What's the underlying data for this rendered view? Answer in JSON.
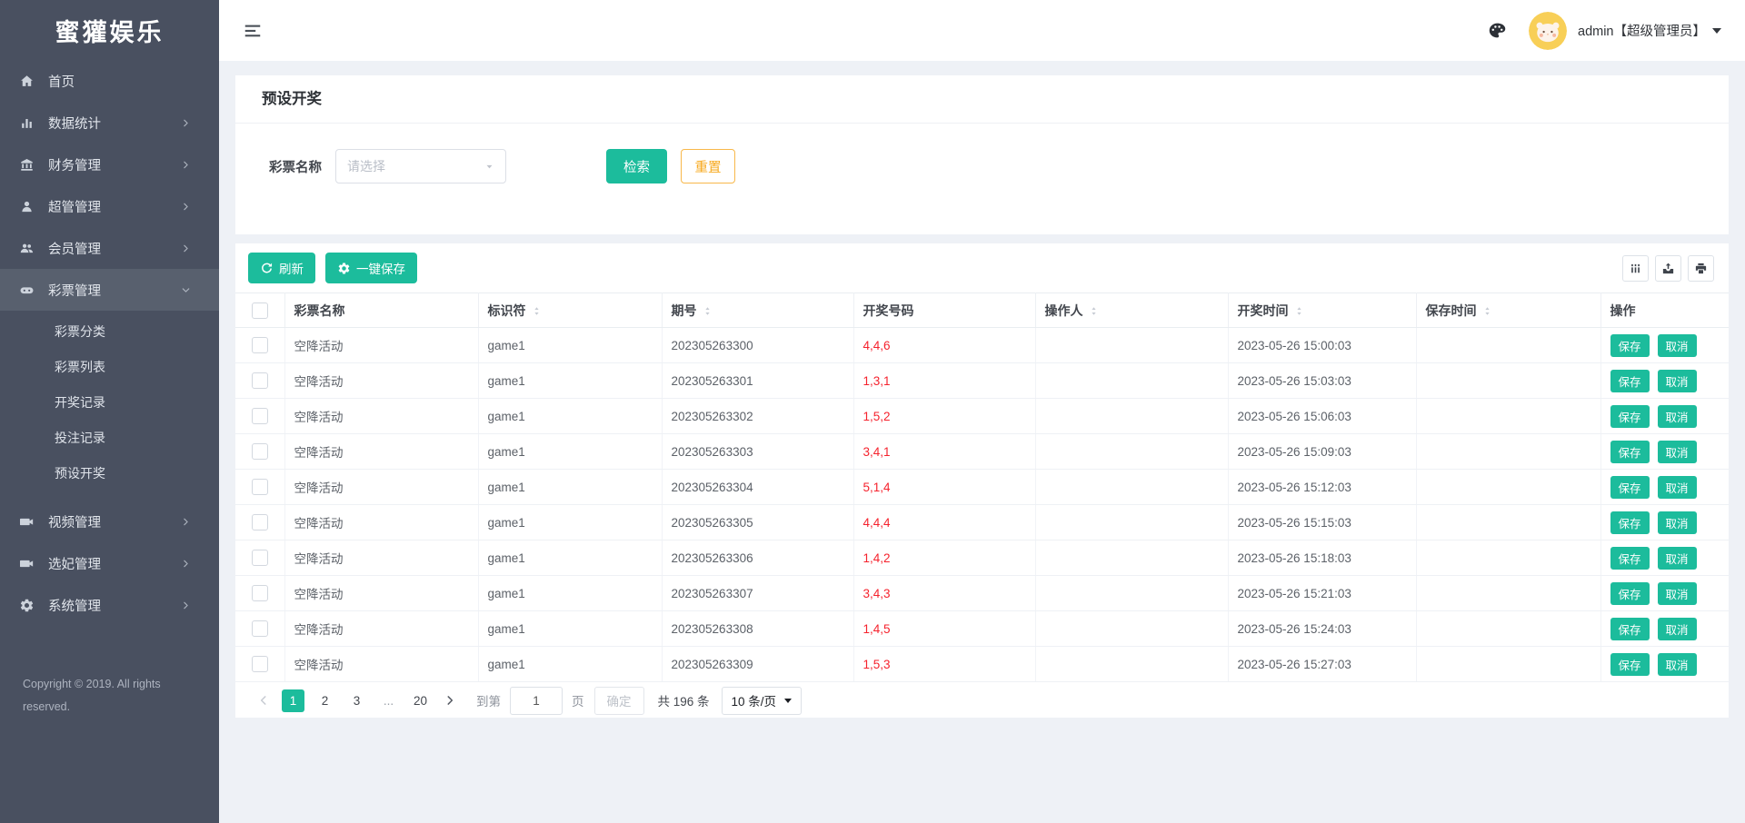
{
  "colors": {
    "accent": "#1cbc9c",
    "warning": "#f7a81c",
    "danger": "#f5222d",
    "sidebar_bg": "#495060",
    "sidebar_active_bg": "#58606e",
    "page_bg": "#eef1f6"
  },
  "sidebar": {
    "logo": "蜜獾娱乐",
    "items": [
      {
        "label": "首页",
        "icon": "home-icon",
        "expandable": false,
        "active": false
      },
      {
        "label": "数据统计",
        "icon": "chart-icon",
        "expandable": true,
        "active": false
      },
      {
        "label": "财务管理",
        "icon": "bank-icon",
        "expandable": true,
        "active": false
      },
      {
        "label": "超管管理",
        "icon": "user-icon",
        "expandable": true,
        "active": false
      },
      {
        "label": "会员管理",
        "icon": "users-icon",
        "expandable": true,
        "active": false
      },
      {
        "label": "彩票管理",
        "icon": "gamepad-icon",
        "expandable": true,
        "expanded": true,
        "active": true,
        "children": [
          "彩票分类",
          "彩票列表",
          "开奖记录",
          "投注记录",
          "预设开奖"
        ]
      },
      {
        "label": "视频管理",
        "icon": "video-icon",
        "expandable": true,
        "active": false
      },
      {
        "label": "选妃管理",
        "icon": "video-icon",
        "expandable": true,
        "active": false
      },
      {
        "label": "系统管理",
        "icon": "gear-icon",
        "expandable": true,
        "active": false
      }
    ],
    "copyright": "Copyright © 2019. All rights reserved."
  },
  "topbar": {
    "menu_icon": "menu-fold-icon",
    "theme_icon": "palette-icon",
    "avatar_icon": "hamster-avatar",
    "username": "admin【超级管理员】"
  },
  "page": {
    "title": "预设开奖",
    "filter": {
      "label": "彩票名称",
      "placeholder": "请选择",
      "search_label": "检索",
      "reset_label": "重置"
    },
    "toolbar": {
      "refresh_label": "刷新",
      "save_all_label": "一键保存",
      "right_icons": [
        "columns-icon",
        "export-icon",
        "print-icon"
      ]
    }
  },
  "table": {
    "columns": [
      {
        "label": "彩票名称",
        "sortable": false
      },
      {
        "label": "标识符",
        "sortable": true
      },
      {
        "label": "期号",
        "sortable": true
      },
      {
        "label": "开奖号码",
        "sortable": false
      },
      {
        "label": "操作人",
        "sortable": true
      },
      {
        "label": "开奖时间",
        "sortable": true
      },
      {
        "label": "保存时间",
        "sortable": true
      },
      {
        "label": "操作",
        "sortable": false
      }
    ],
    "rows": [
      {
        "name": "空降活动",
        "code": "game1",
        "issue": "202305263300",
        "numbers": "4,4,6",
        "operator": "",
        "draw_time": "2023-05-26 15:00:03",
        "save_time": ""
      },
      {
        "name": "空降活动",
        "code": "game1",
        "issue": "202305263301",
        "numbers": "1,3,1",
        "operator": "",
        "draw_time": "2023-05-26 15:03:03",
        "save_time": ""
      },
      {
        "name": "空降活动",
        "code": "game1",
        "issue": "202305263302",
        "numbers": "1,5,2",
        "operator": "",
        "draw_time": "2023-05-26 15:06:03",
        "save_time": ""
      },
      {
        "name": "空降活动",
        "code": "game1",
        "issue": "202305263303",
        "numbers": "3,4,1",
        "operator": "",
        "draw_time": "2023-05-26 15:09:03",
        "save_time": ""
      },
      {
        "name": "空降活动",
        "code": "game1",
        "issue": "202305263304",
        "numbers": "5,1,4",
        "operator": "",
        "draw_time": "2023-05-26 15:12:03",
        "save_time": ""
      },
      {
        "name": "空降活动",
        "code": "game1",
        "issue": "202305263305",
        "numbers": "4,4,4",
        "operator": "",
        "draw_time": "2023-05-26 15:15:03",
        "save_time": ""
      },
      {
        "name": "空降活动",
        "code": "game1",
        "issue": "202305263306",
        "numbers": "1,4,2",
        "operator": "",
        "draw_time": "2023-05-26 15:18:03",
        "save_time": ""
      },
      {
        "name": "空降活动",
        "code": "game1",
        "issue": "202305263307",
        "numbers": "3,4,3",
        "operator": "",
        "draw_time": "2023-05-26 15:21:03",
        "save_time": ""
      },
      {
        "name": "空降活动",
        "code": "game1",
        "issue": "202305263308",
        "numbers": "1,4,5",
        "operator": "",
        "draw_time": "2023-05-26 15:24:03",
        "save_time": ""
      },
      {
        "name": "空降活动",
        "code": "game1",
        "issue": "202305263309",
        "numbers": "1,5,3",
        "operator": "",
        "draw_time": "2023-05-26 15:27:03",
        "save_time": ""
      }
    ],
    "actions": {
      "save": "保存",
      "cancel": "取消"
    }
  },
  "pagination": {
    "pages": [
      "1",
      "2",
      "3",
      "...",
      "20"
    ],
    "active_page": "1",
    "goto_label": "到第",
    "goto_value": "1",
    "page_unit": "页",
    "confirm_label": "确定",
    "total_label": "共 196 条",
    "page_size_label": "10 条/页"
  }
}
